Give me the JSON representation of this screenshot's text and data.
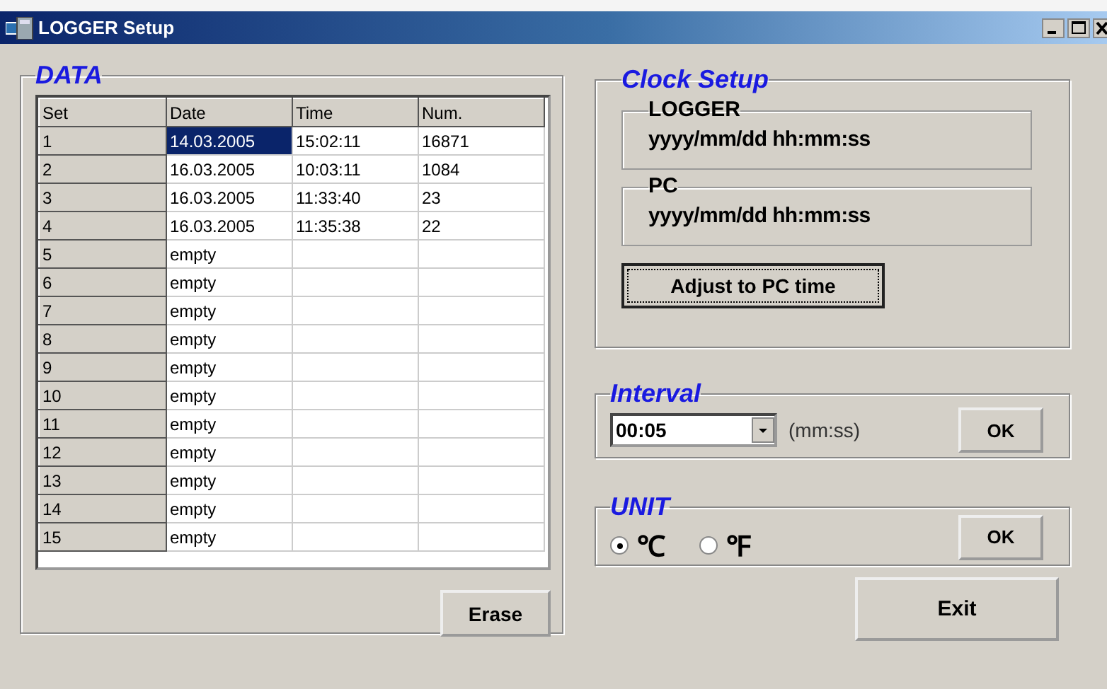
{
  "window": {
    "title": "LOGGER Setup"
  },
  "data": {
    "title": "DATA",
    "columns": [
      "Set",
      "Date",
      "Time",
      "Num."
    ],
    "rows": [
      {
        "set": "1",
        "date": "14.03.2005",
        "time": "15:02:11",
        "num": "16871",
        "selected": true
      },
      {
        "set": "2",
        "date": "16.03.2005",
        "time": "10:03:11",
        "num": "1084",
        "selected": false
      },
      {
        "set": "3",
        "date": "16.03.2005",
        "time": "11:33:40",
        "num": "23",
        "selected": false
      },
      {
        "set": "4",
        "date": "16.03.2005",
        "time": "11:35:38",
        "num": "22",
        "selected": false
      },
      {
        "set": "5",
        "date": "empty",
        "selected": false
      },
      {
        "set": "6",
        "date": "empty",
        "selected": false
      },
      {
        "set": "7",
        "date": "empty",
        "selected": false
      },
      {
        "set": "8",
        "date": "empty",
        "selected": false
      },
      {
        "set": "9",
        "date": "empty",
        "selected": false
      },
      {
        "set": "10",
        "date": "empty",
        "selected": false
      },
      {
        "set": "11",
        "date": "empty",
        "selected": false
      },
      {
        "set": "12",
        "date": "empty",
        "selected": false
      },
      {
        "set": "13",
        "date": "empty",
        "selected": false
      },
      {
        "set": "14",
        "date": "empty",
        "selected": false
      },
      {
        "set": "15",
        "date": "empty",
        "selected": false
      }
    ],
    "erase_button": "Erase"
  },
  "clock_setup": {
    "title": "Clock Setup",
    "logger": {
      "title": "LOGGER",
      "value": "yyyy/mm/dd hh:mm:ss"
    },
    "pc": {
      "title": "PC",
      "value": "yyyy/mm/dd hh:mm:ss"
    },
    "adjust_button": "Adjust to PC time"
  },
  "interval": {
    "title": "Interval",
    "value": "00:05",
    "unit": "(mm:ss)",
    "ok_button": "OK"
  },
  "unit": {
    "title": "UNIT",
    "options": [
      {
        "label": "℃",
        "selected": true
      },
      {
        "label": "℉",
        "selected": false
      }
    ],
    "ok_button": "OK"
  },
  "exit_button": "Exit"
}
